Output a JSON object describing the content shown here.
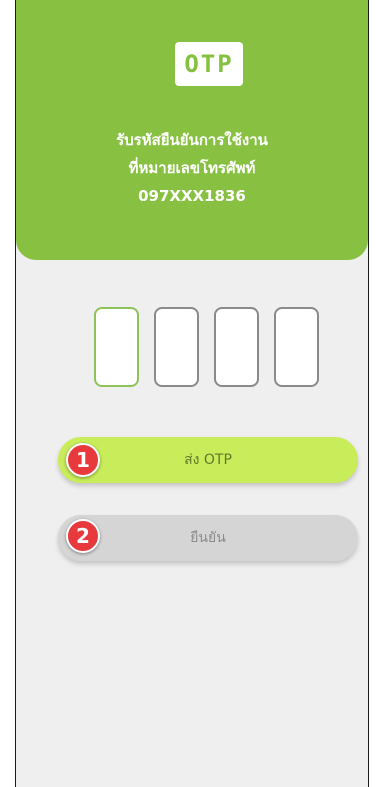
{
  "header": {
    "logo_text": "OTP",
    "line1": "รับรหัสยืนยันการใช้งาน",
    "line2": "ที่หมายเลขโทรศัพท์",
    "phone": "097XXX1836",
    "color": "#88c142"
  },
  "otp_inputs": [
    {
      "value": ""
    },
    {
      "value": ""
    },
    {
      "value": ""
    },
    {
      "value": ""
    }
  ],
  "buttons": {
    "send_label": "ส่ง OTP",
    "confirm_label": "ยืนยัน"
  },
  "markers": {
    "m1": "1",
    "m2": "2"
  }
}
